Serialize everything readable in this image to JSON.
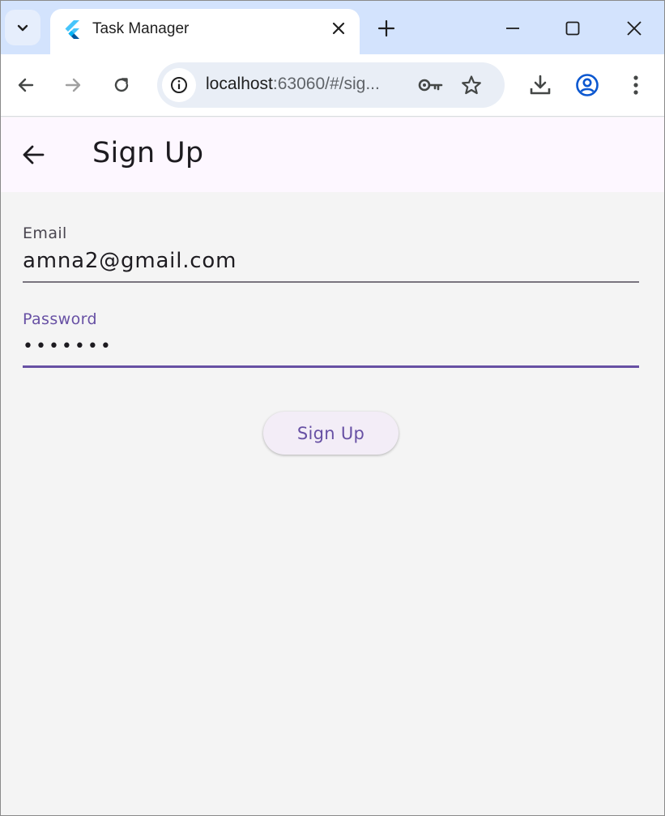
{
  "browser": {
    "tab": {
      "title": "Task Manager",
      "favicon": "flutter-logo-icon"
    },
    "url_host": "localhost",
    "url_rest": ":63060/#/sig...",
    "icons": {
      "tab_search": "chevron-down-icon",
      "tab_close": "close-icon",
      "new_tab": "plus-icon",
      "minimize": "minimize-icon",
      "maximize": "maximize-icon",
      "close": "close-icon",
      "back": "arrow-left-icon",
      "forward": "arrow-right-icon",
      "reload": "reload-icon",
      "site_info": "info-icon",
      "password_key": "key-icon",
      "bookmark": "star-icon",
      "download": "download-icon",
      "profile": "account-circle-icon",
      "menu": "more-vert-icon"
    }
  },
  "app": {
    "title": "Sign Up",
    "back_icon": "arrow-left-icon",
    "email": {
      "label": "Email",
      "value": "amna2@gmail.com"
    },
    "password": {
      "label": "Password",
      "value": "•••••••"
    },
    "submit_label": "Sign Up"
  },
  "colors": {
    "tabstrip_bg": "#d3e3fd",
    "appbar_bg": "#fdf7ff",
    "page_bg": "#f4f4f4",
    "accent": "#6750a4",
    "profile_blue": "#0b57d0"
  }
}
